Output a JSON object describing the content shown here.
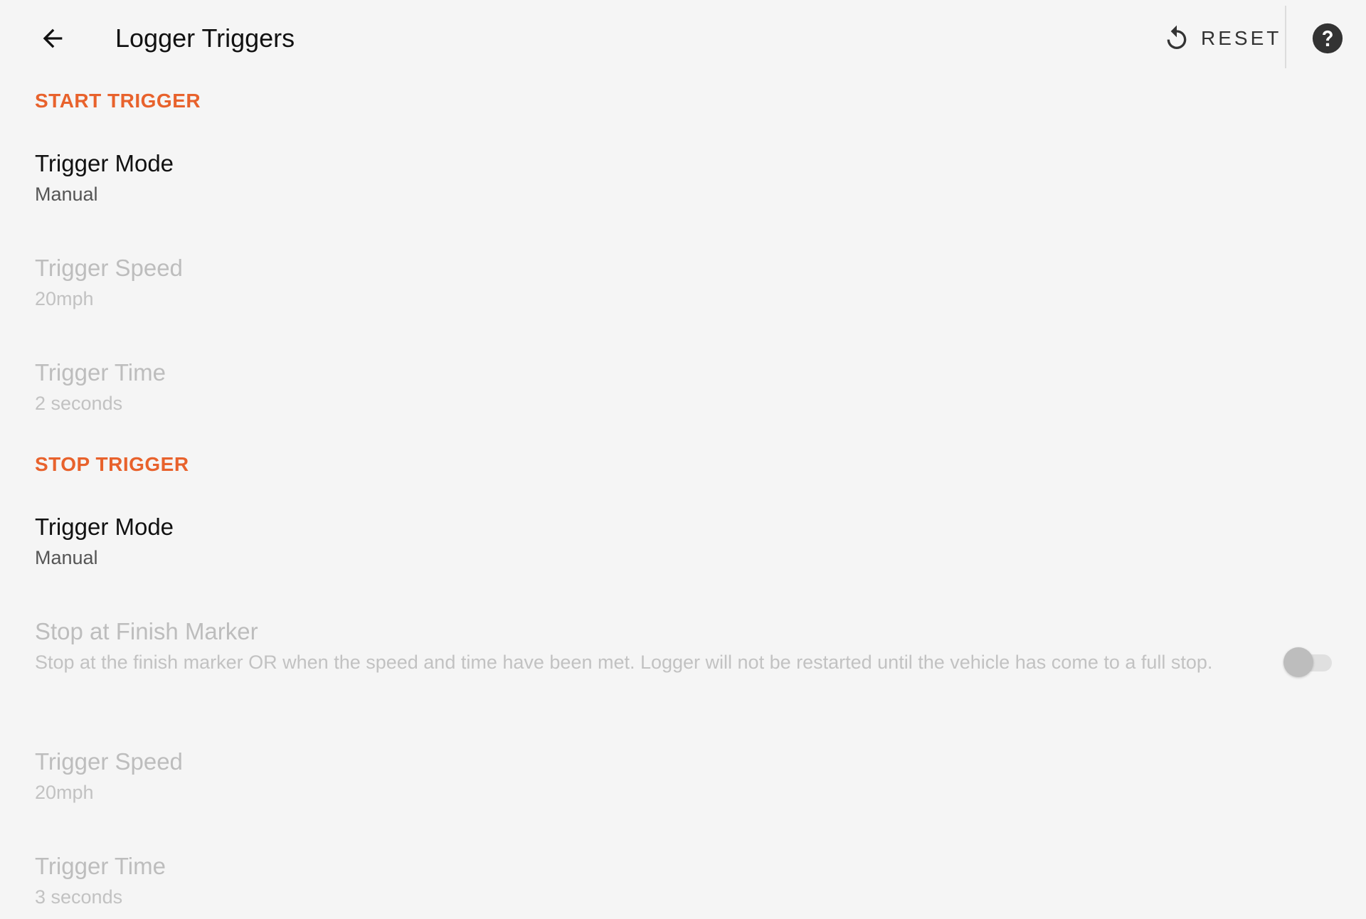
{
  "header": {
    "title": "Logger Triggers",
    "back_icon": "arrow-back-icon",
    "reset_label": "RESET",
    "reset_icon": "refresh-icon",
    "help_icon": "help-circle-icon"
  },
  "start_trigger": {
    "header": "START TRIGGER",
    "items": [
      {
        "title": "Trigger Mode",
        "summary": "Manual",
        "enabled": true
      },
      {
        "title": "Trigger Speed",
        "summary": "20mph",
        "enabled": false
      },
      {
        "title": "Trigger Time",
        "summary": "2 seconds",
        "enabled": false
      }
    ]
  },
  "stop_trigger": {
    "header": "STOP TRIGGER",
    "items": [
      {
        "title": "Trigger Mode",
        "summary": "Manual",
        "enabled": true
      },
      {
        "title": "Stop at Finish Marker",
        "summary": "Stop at the finish marker OR when the speed and time have been met. Logger will not be restarted until the vehicle has come to a full stop.",
        "enabled": false,
        "toggle_on": false
      },
      {
        "title": "Trigger Speed",
        "summary": "20mph",
        "enabled": false
      },
      {
        "title": "Trigger Time",
        "summary": "3 seconds",
        "enabled": false
      }
    ]
  },
  "colors": {
    "accent": "#e8622c",
    "background": "#f5f5f5",
    "disabled_text": "#bdbdbd"
  }
}
